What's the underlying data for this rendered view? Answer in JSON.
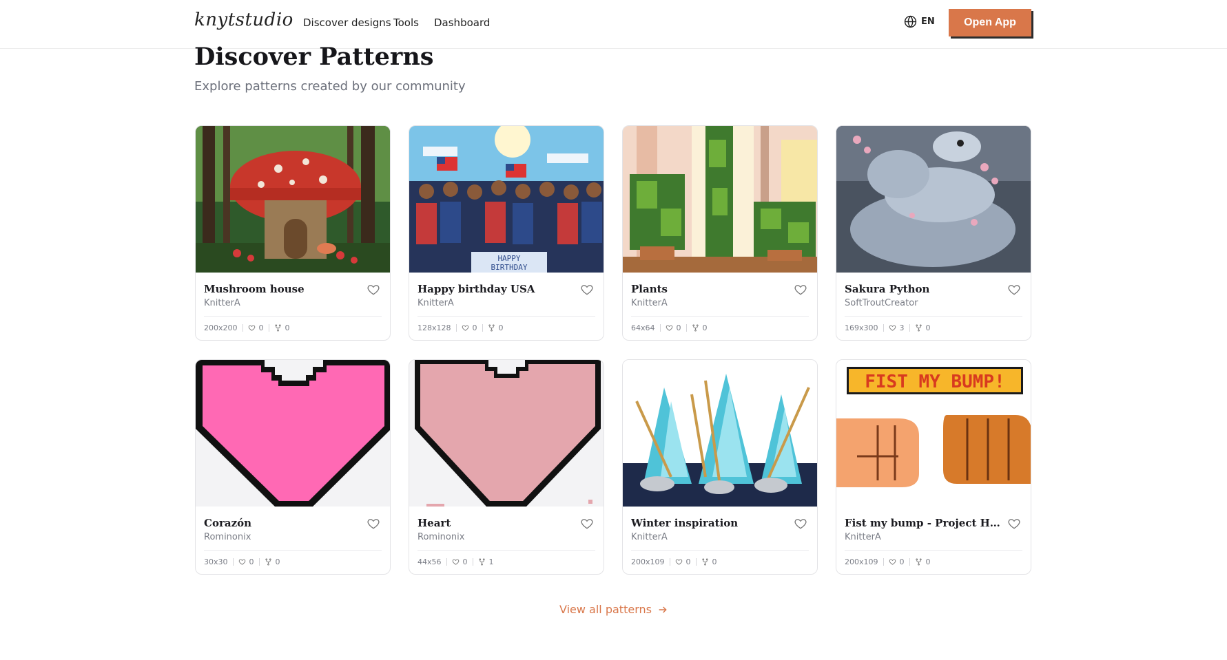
{
  "brand": {
    "logo_text": "knytstudio",
    "accent": "#d9774a"
  },
  "nav": {
    "links": [
      "Discover designs",
      "Tools",
      "Dashboard"
    ],
    "language": "EN",
    "open_app_label": "Open App"
  },
  "header": {
    "title": "Discover Patterns",
    "subtitle": "Explore patterns created by our community"
  },
  "patterns": [
    {
      "title": "Mushroom house",
      "author": "KnitterA",
      "size": "200x200",
      "likes": "0",
      "forks": "0",
      "thumb": "mushroom"
    },
    {
      "title": "Happy birthday USA",
      "author": "KnitterA",
      "size": "128x128",
      "likes": "0",
      "forks": "0",
      "thumb": "birthday"
    },
    {
      "title": "Plants",
      "author": "KnitterA",
      "size": "64x64",
      "likes": "0",
      "forks": "0",
      "thumb": "plants"
    },
    {
      "title": "Sakura Python",
      "author": "SoftTroutCreator",
      "size": "169x300",
      "likes": "3",
      "forks": "0",
      "thumb": "python"
    },
    {
      "title": "Corazón",
      "author": "Rominonix",
      "size": "30x30",
      "likes": "0",
      "forks": "0",
      "thumb": "heart-pink"
    },
    {
      "title": "Heart",
      "author": "Rominonix",
      "size": "44x56",
      "likes": "0",
      "forks": "1",
      "thumb": "heart-rose"
    },
    {
      "title": "Winter inspiration",
      "author": "KnitterA",
      "size": "200x109",
      "likes": "0",
      "forks": "0",
      "thumb": "winter"
    },
    {
      "title": "Fist my bump - Project Hail ...",
      "author": "KnitterA",
      "size": "200x109",
      "likes": "0",
      "forks": "0",
      "thumb": "fist",
      "banner_text": "FIST MY BUMP!"
    }
  ],
  "footer": {
    "view_all_label": "View all patterns"
  }
}
